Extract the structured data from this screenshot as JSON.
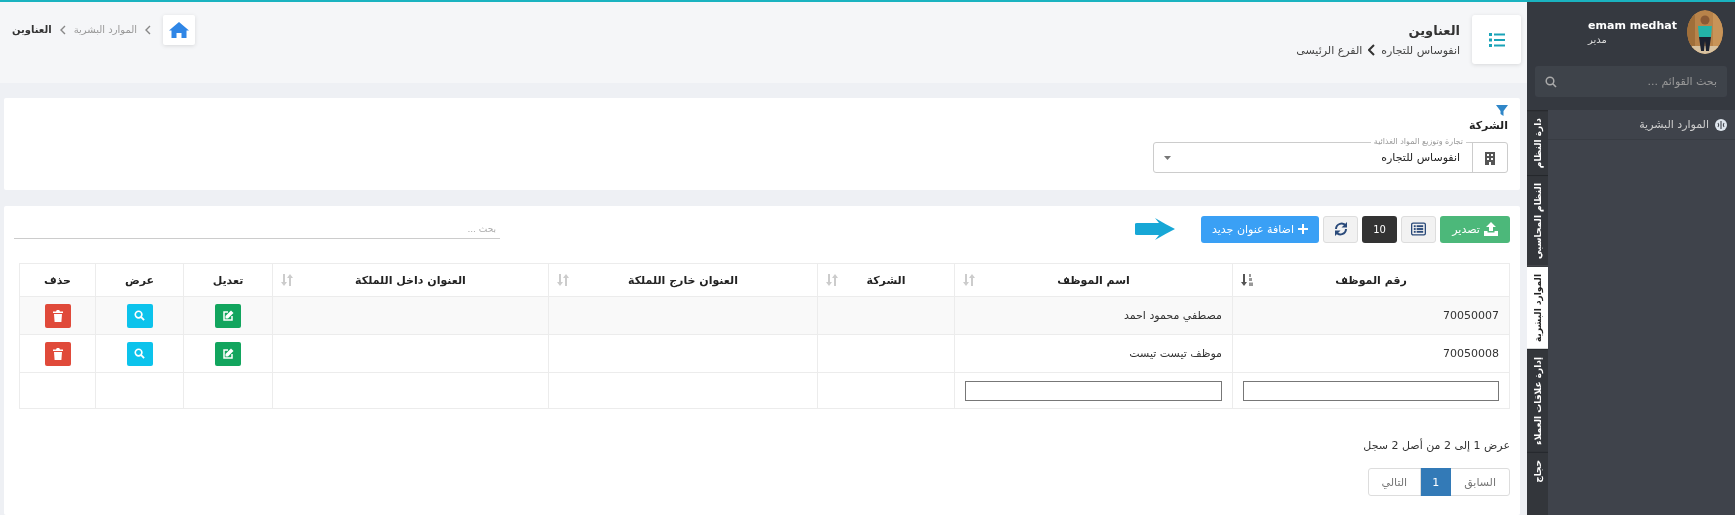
{
  "sidebar": {
    "user": {
      "name": "emam medhat",
      "role": "مدير"
    },
    "search": {
      "placeholder": "بحث القوائم ..."
    },
    "menu_items": [
      {
        "label": "الموارد البشرية"
      }
    ],
    "tabs": [
      {
        "label": "دارة النظام",
        "selected": false
      },
      {
        "label": "النظام المحاسبي",
        "selected": false
      },
      {
        "label": "الموارد البشرية",
        "selected": true
      },
      {
        "label": "إدارة علاقات العملاء",
        "selected": false
      },
      {
        "label": "حجاج",
        "selected": false
      }
    ]
  },
  "header": {
    "title": "العناوين",
    "path": [
      "انفوساس للتجاره",
      "الفرع الرئيسى"
    ],
    "breadcrumb": [
      "الموارد البشرية",
      "العناوين"
    ]
  },
  "filter": {
    "label": "الشركة",
    "select": {
      "label": "تجارة وتوزيع المواد الغذائية",
      "value": "انفوساس للتجاره"
    }
  },
  "toolbar": {
    "export": "تصدير",
    "page_size": "10",
    "add": "اضافة عنوان جديد",
    "search": {
      "placeholder": "بحث ..."
    }
  },
  "table": {
    "columns": [
      {
        "label": "رقم الموظف",
        "kind": "text",
        "sortable": true,
        "sorted": true,
        "filterable": true
      },
      {
        "label": "اسم الموظف",
        "kind": "text",
        "sortable": true,
        "sorted": false,
        "filterable": true
      },
      {
        "label": "الشركة",
        "kind": "text",
        "sortable": true,
        "sorted": false,
        "filterable": false
      },
      {
        "label": "العنوان خارج اللملكة",
        "kind": "text",
        "sortable": true,
        "sorted": false,
        "filterable": false
      },
      {
        "label": "العنوان داخل اللملكة",
        "kind": "text",
        "sortable": true,
        "sorted": false,
        "filterable": false
      },
      {
        "label": "تعديل",
        "kind": "edit",
        "sortable": false,
        "filterable": false
      },
      {
        "label": "عرض",
        "kind": "view",
        "sortable": false,
        "filterable": false
      },
      {
        "label": "حذف",
        "kind": "delete",
        "sortable": false,
        "filterable": false
      }
    ],
    "rows": [
      {
        "cells": [
          "70050007",
          "مصطفي محمود احمد"
        ]
      },
      {
        "cells": [
          "70050008",
          "موظف تيست تيست"
        ]
      }
    ]
  },
  "pagination": {
    "info": "عرض 1 إلى 2 من أصل 2 سجل",
    "pages": [
      {
        "label": "السابق",
        "kind": "prev",
        "selected": false
      },
      {
        "label": "1",
        "kind": "page",
        "selected": true
      },
      {
        "label": "التالي",
        "kind": "next",
        "selected": false
      }
    ]
  }
}
